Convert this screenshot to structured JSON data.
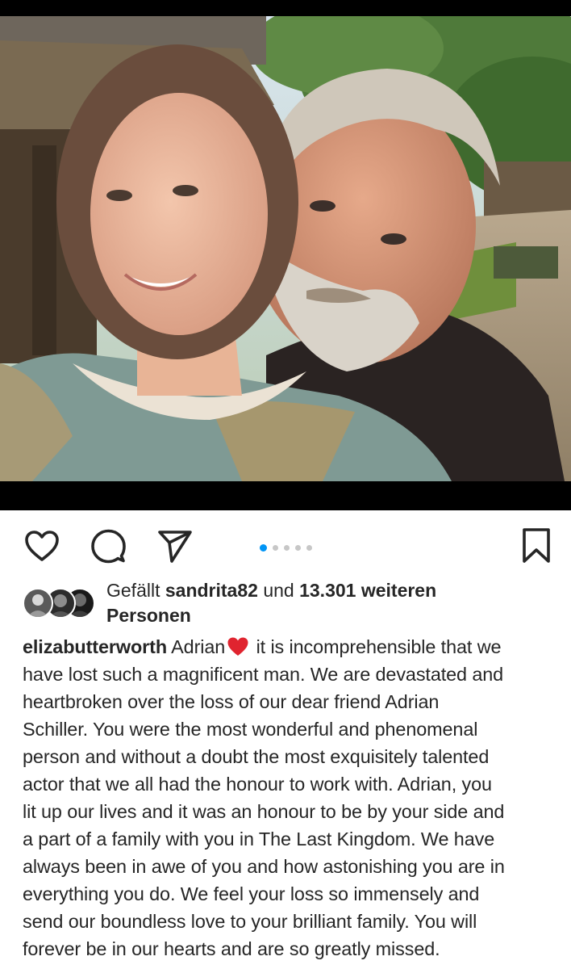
{
  "post": {
    "photo_alt": "selfie",
    "carousel": {
      "count": 5,
      "active_index": 0
    }
  },
  "actions": {
    "like_icon": "heart-outline-icon",
    "comment_icon": "speech-bubble-icon",
    "share_icon": "paper-plane-icon",
    "save_icon": "bookmark-outline-icon"
  },
  "likes": {
    "prefix": "Gefällt ",
    "user": "sandrita82",
    "middle": " und ",
    "count": "13.301 weiteren",
    "suffix": "Personen"
  },
  "caption": {
    "username": "elizabutterworth",
    "first_word": "Adrian",
    "emoji": "red-heart-emoji",
    "lines": [
      "it is incomprehensible that we",
      "have lost such a magnificent man. We are devastated and",
      "heartbroken over the loss of our dear friend Adrian",
      "Schiller. You were the most wonderful and phenomenal",
      "person and without a doubt the most exquisitely talented",
      "actor that we all had the honour to work with. Adrian, you",
      "lit up our lives and it was an honour to be by your side and",
      "a part of a family with you in The Last Kingdom. We have",
      "always been in awe of you and how astonishing you are in",
      "everything you do. We feel your loss so immensely and",
      "send our boundless love to your brilliant family. You will",
      "forever be in our hearts and are so greatly missed."
    ]
  },
  "colors": {
    "accent_blue": "#0095f6",
    "heart_red": "#e0242f",
    "text": "#262626"
  }
}
